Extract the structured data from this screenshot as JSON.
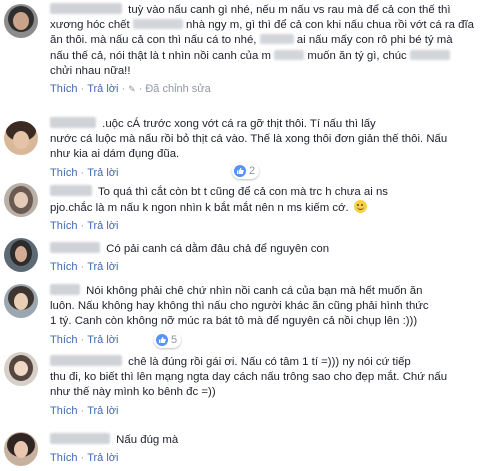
{
  "actions": {
    "like": "Thích",
    "reply": "Trả lời",
    "edited": "Đã chỉnh sửa",
    "sep": "·"
  },
  "comments": [
    {
      "lines": [
        "tuỳ vào nấu canh gì nhé, nếu m nấu vs rau mà để cả con thế thì",
        "xương hóc chết",
        "nhà ngy m, gì thì để cả con khi nấu chua rồi vớt cá ra đĩa",
        "ăn thôi. mà nấu cả con thì nấu cá to nhé,",
        "ai nấu mấy con rô phi bé tý mà",
        "nấu thế cả, nói thật là t nhìn nồi canh của m",
        "muốn ăn tý gì, chúc",
        "chửi nhau nữa!!"
      ],
      "edited": true
    },
    {
      "lines": [
        ".uộc cÁ trước xong vớt cá ra gỡ thịt thôi. Tí nấu thì lấy",
        "nước cá luộc mà nấu rồi bỏ thịt cá vào. Thế là xong thôi đơn giản thế thôi. Nấu",
        "như kia ai dám đụng đũa."
      ],
      "reactions": "2"
    },
    {
      "lines": [
        "To quá thì cắt còn bt t cũng để cả con mà trc h chưa ai ns",
        "pjo.chắc là m nấu k ngon nhìn k bắt mắt nên n ms kiếm cớ."
      ]
    },
    {
      "lines": [
        "Có pải canh cá dằm đâu chả để nguyên con"
      ]
    },
    {
      "lines": [
        "Nói không phải chê chứ nhìn nồi canh cá của bạn mà hết muốn ăn",
        "luôn. Nấu không hay không thì nấu cho người khác ăn cũng phải hình thức",
        "1 tý. Canh còn không nỡ múc ra bát tô mà để nguyên cả nồi chụp lên :)))"
      ],
      "reactions": "5"
    },
    {
      "lines": [
        "chê là đúng rồi gái ơi. Nấu có tâm 1 tí =))) ny nói cứ tiếp",
        "thu đi, ko biết thì lên mạng ngta day cách nấu trông sao cho đẹp mắt. Chứ nấu",
        "như thế này mình ko bênh đc =))"
      ]
    },
    {
      "lines": [
        "Nấu đúg mà"
      ]
    }
  ],
  "colors": {
    "link": "#4267b2",
    "meta": "#9197a3",
    "text": "#1d2129",
    "like": "#5890ff"
  }
}
